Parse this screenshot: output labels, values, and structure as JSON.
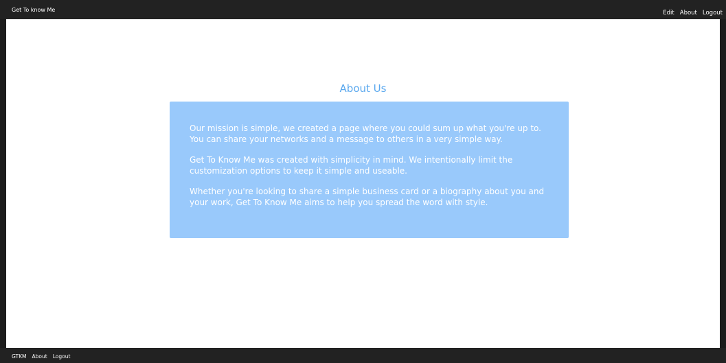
{
  "header": {
    "brand": "Get To know Me",
    "nav": [
      "Edit",
      "About",
      "Logout"
    ]
  },
  "main": {
    "title": "About Us",
    "paragraphs": [
      "Our mission is simple, we created a page where you could sum up what you're up to. You can share your networks and a message to others in a very simple way.",
      "Get To Know Me was created with simplicity in mind. We intentionally limit the customization options to keep it simple and useable.",
      "Whether you're looking to share a simple business card or a biography about you and your work, Get To Know Me aims to help you spread the word with style."
    ]
  },
  "footer": {
    "nav": [
      "GTKM",
      "About",
      "Logout"
    ]
  },
  "colors": {
    "bar": "#222222",
    "heading": "#5aa8ee",
    "card": "#99c9fb"
  }
}
